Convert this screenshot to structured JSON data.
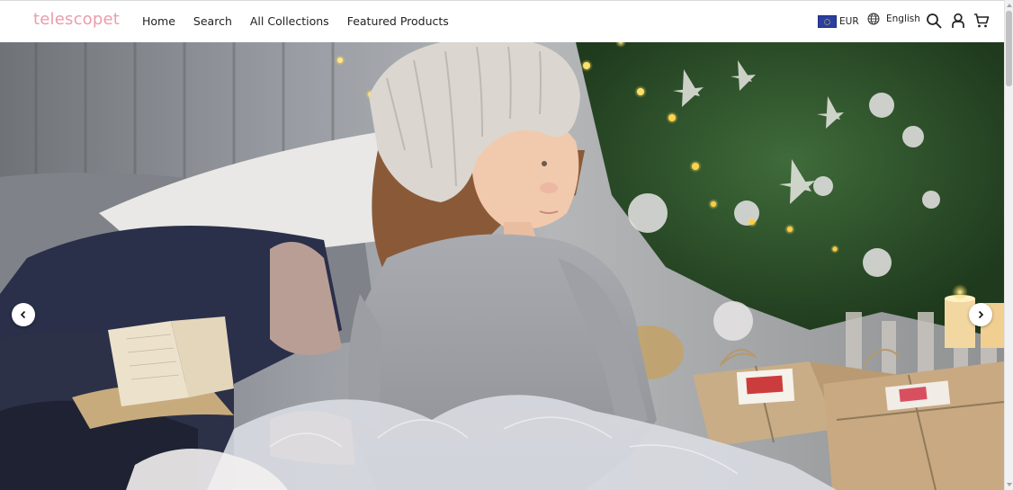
{
  "brand": {
    "logo_text": "telescopet",
    "logo_color": "#ea9dab"
  },
  "nav": {
    "items": [
      {
        "label": "Home"
      },
      {
        "label": "Search"
      },
      {
        "label": "All Collections"
      },
      {
        "label": "Featured Products"
      }
    ]
  },
  "tools": {
    "currency": {
      "label": "EUR",
      "flag": "eu-flag-icon"
    },
    "language": {
      "label": "English",
      "icon": "globe-icon"
    },
    "icons": [
      "search-icon",
      "user-icon",
      "cart-icon"
    ]
  },
  "hero": {
    "image": "child-in-knit-hat-christmas-photo",
    "prev_icon": "chevron-left-icon",
    "next_icon": "chevron-right-icon"
  }
}
